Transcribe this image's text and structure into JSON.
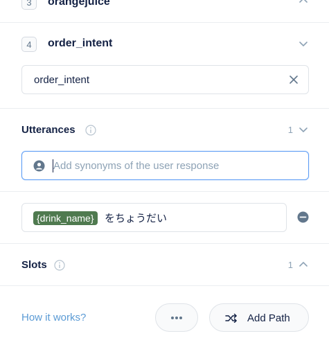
{
  "paths": [
    {
      "number": "3",
      "title": "orangejuice"
    },
    {
      "number": "4",
      "title": "order_intent"
    }
  ],
  "intent_input": {
    "value": "order_intent"
  },
  "utterances": {
    "title": "Utterances",
    "count": "1",
    "synonym_placeholder": "Add synonyms of the user response",
    "items": [
      {
        "slot": "{drink_name}",
        "text": "をちょうだい"
      }
    ]
  },
  "slots": {
    "title": "Slots",
    "count": "1"
  },
  "footer": {
    "how_it_works": "How it works?",
    "more_label": "•••",
    "add_path_label": "Add Path"
  },
  "colors": {
    "accent_blue": "#5d9df5",
    "slot_chip": "#4f7a4f",
    "link": "#5b9bd5"
  }
}
